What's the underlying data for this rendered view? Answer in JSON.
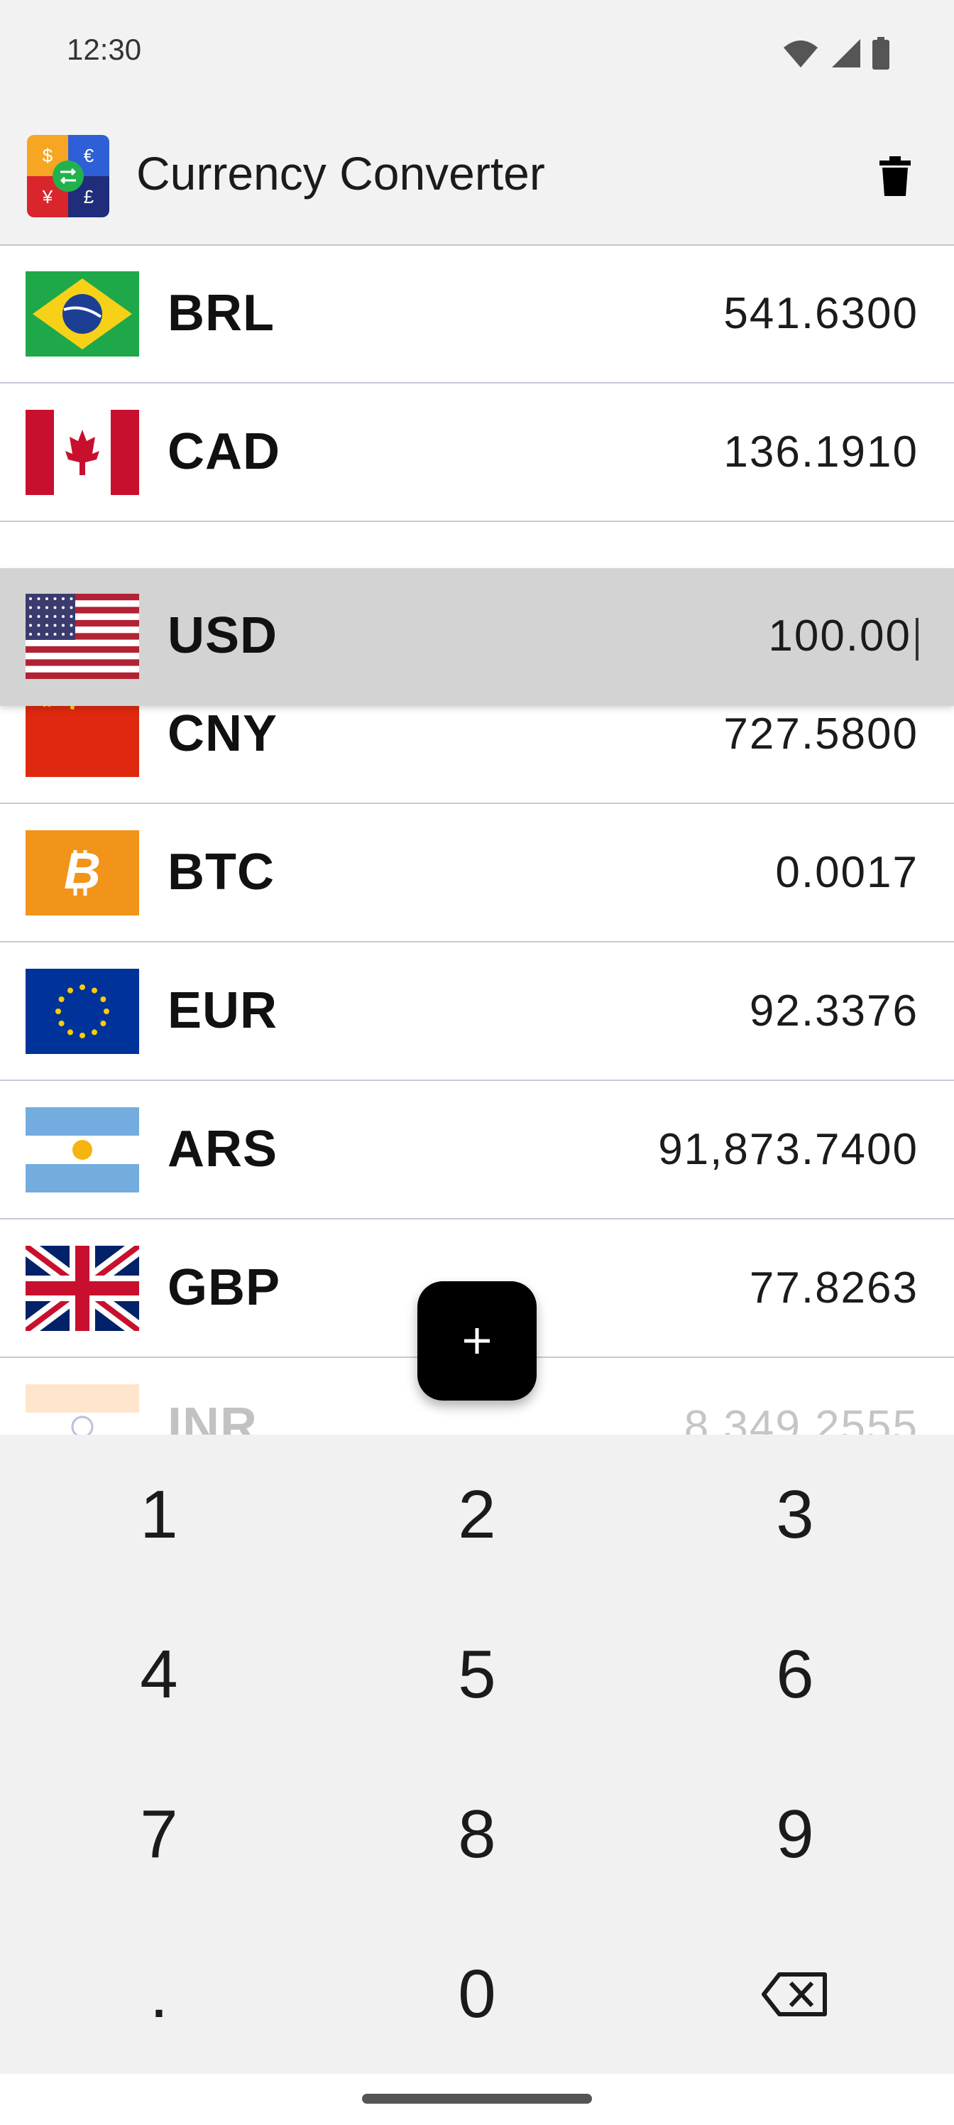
{
  "status": {
    "time": "12:30"
  },
  "appbar": {
    "title": "Currency Converter",
    "logo_glyphs": [
      "$",
      "€",
      "¥",
      "£"
    ]
  },
  "rows": [
    {
      "code": "BRL",
      "amount": "541.6300",
      "flag": "brazil-flag-icon"
    },
    {
      "code": "CAD",
      "amount": "136.1910",
      "flag": "canada-flag-icon"
    },
    {
      "code": "USD",
      "amount": "100.00",
      "flag": "usa-flag-icon",
      "selected": true
    },
    {
      "code": "CNY",
      "amount": "727.5800",
      "flag": "china-flag-icon"
    },
    {
      "code": "BTC",
      "amount": "0.0017",
      "flag": "bitcoin-icon"
    },
    {
      "code": "EUR",
      "amount": "92.3376",
      "flag": "eu-flag-icon"
    },
    {
      "code": "ARS",
      "amount": "91,873.7400",
      "flag": "argentina-flag-icon"
    },
    {
      "code": "GBP",
      "amount": "77.8263",
      "flag": "uk-flag-icon"
    },
    {
      "code": "INR",
      "amount": "8,349.2555",
      "flag": "india-flag-icon"
    }
  ],
  "keypad": {
    "keys": [
      "1",
      "2",
      "3",
      "4",
      "5",
      "6",
      "7",
      "8",
      "9",
      ".",
      "0"
    ],
    "backspace": "backspace-icon"
  },
  "fab": {
    "icon": "plus-icon"
  }
}
